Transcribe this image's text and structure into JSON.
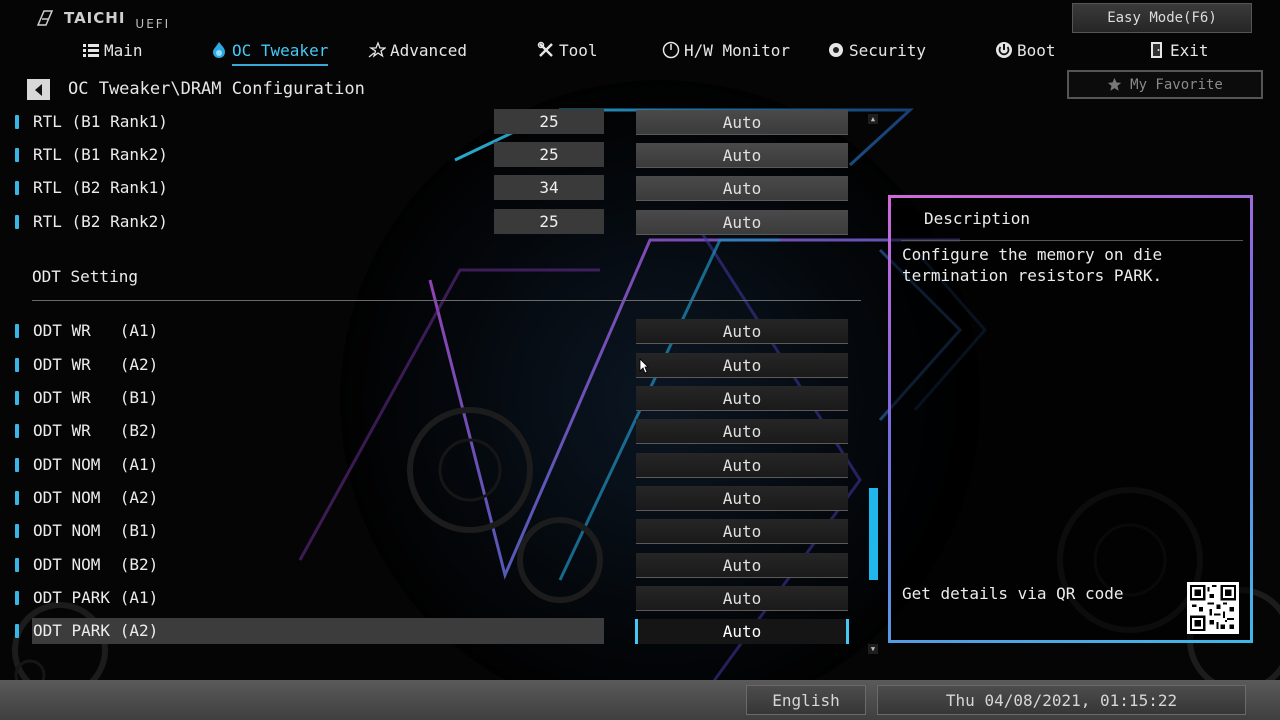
{
  "header": {
    "logo_name": "TAICHI",
    "logo_suffix": "UEFI",
    "easy_mode_label": "Easy Mode(F6)",
    "favorite_label": "My Favorite"
  },
  "nav": [
    {
      "label": "Main",
      "icon": "list-icon"
    },
    {
      "label": "OC Tweaker",
      "icon": "flame-icon",
      "active": true
    },
    {
      "label": "Advanced",
      "icon": "star-arrow-icon"
    },
    {
      "label": "Tool",
      "icon": "wrench-icon"
    },
    {
      "label": "H/W Monitor",
      "icon": "monitor-gauge-icon"
    },
    {
      "label": "Security",
      "icon": "shield-gear-icon"
    },
    {
      "label": "Boot",
      "icon": "power-icon"
    },
    {
      "label": "Exit",
      "icon": "exit-door-icon"
    }
  ],
  "breadcrumb": "OC Tweaker\\DRAM Configuration",
  "rtl_rows": [
    {
      "label": "RTL (B1 Rank1)",
      "value": "25",
      "option": "Auto"
    },
    {
      "label": "RTL (B1 Rank2)",
      "value": "25",
      "option": "Auto"
    },
    {
      "label": "RTL (B2 Rank1)",
      "value": "34",
      "option": "Auto"
    },
    {
      "label": "RTL (B2 Rank2)",
      "value": "25",
      "option": "Auto"
    }
  ],
  "section_title": "ODT Setting",
  "odt_rows": [
    {
      "label": "ODT WR   (A1)",
      "option": "Auto"
    },
    {
      "label": "ODT WR   (A2)",
      "option": "Auto"
    },
    {
      "label": "ODT WR   (B1)",
      "option": "Auto"
    },
    {
      "label": "ODT WR   (B2)",
      "option": "Auto"
    },
    {
      "label": "ODT NOM  (A1)",
      "option": "Auto"
    },
    {
      "label": "ODT NOM  (A2)",
      "option": "Auto"
    },
    {
      "label": "ODT NOM  (B1)",
      "option": "Auto"
    },
    {
      "label": "ODT NOM  (B2)",
      "option": "Auto"
    },
    {
      "label": "ODT PARK (A1)",
      "option": "Auto"
    },
    {
      "label": "ODT PARK (A2)",
      "option": "Auto",
      "selected": true
    }
  ],
  "description": {
    "title": "Description",
    "text": "Configure the memory on die termination resistors PARK.",
    "qr_label": "Get details via QR code"
  },
  "footer": {
    "language": "English",
    "datetime": "Thu 04/08/2021, 01:15:22"
  },
  "colors": {
    "accent": "#38b6e6",
    "active_nav": "#46c8f5",
    "desc_border_top": "#d06ad8",
    "desc_border_bottom": "#3fb8e8"
  }
}
